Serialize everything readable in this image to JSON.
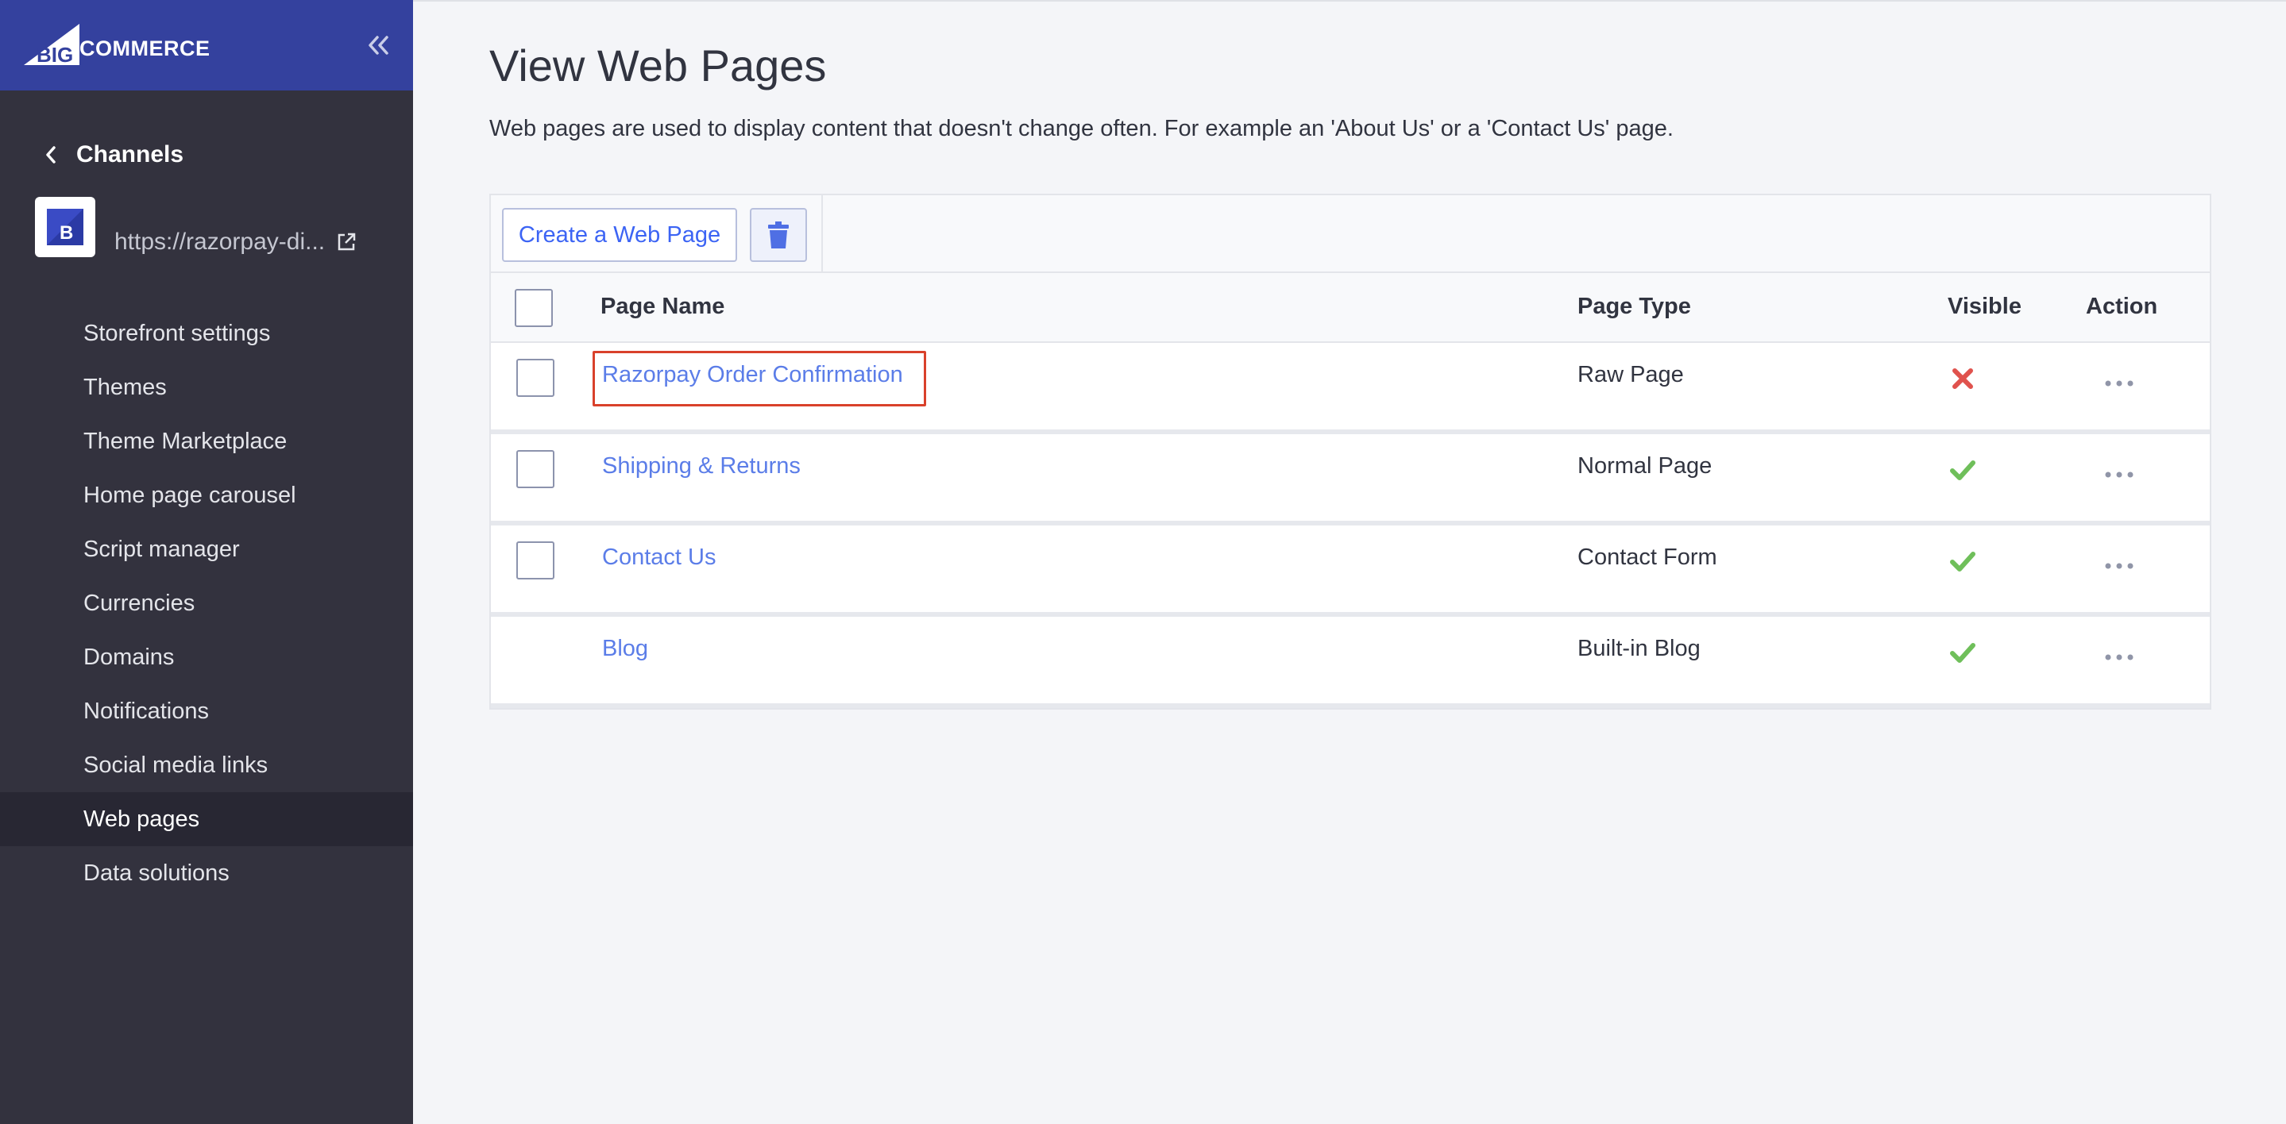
{
  "brand": {
    "logo_text": "COMMERCE",
    "logo_prefix": "BIG",
    "accent": "#34419e"
  },
  "sidebar": {
    "back_label": "Channels",
    "store_url": "https://razorpay-di...",
    "items": [
      {
        "label": "Storefront settings",
        "active": false
      },
      {
        "label": "Themes",
        "active": false
      },
      {
        "label": "Theme Marketplace",
        "active": false
      },
      {
        "label": "Home page carousel",
        "active": false
      },
      {
        "label": "Script manager",
        "active": false
      },
      {
        "label": "Currencies",
        "active": false
      },
      {
        "label": "Domains",
        "active": false
      },
      {
        "label": "Notifications",
        "active": false
      },
      {
        "label": "Social media links",
        "active": false
      },
      {
        "label": "Web pages",
        "active": true
      },
      {
        "label": "Data solutions",
        "active": false
      }
    ]
  },
  "main": {
    "title": "View Web Pages",
    "description": "Web pages are used to display content that doesn't change often. For example an 'About Us' or a 'Contact Us' page.",
    "toolbar": {
      "create_label": "Create a Web Page",
      "delete_icon": "trash-icon"
    },
    "table": {
      "columns": {
        "name": "Page Name",
        "type": "Page Type",
        "visible": "Visible",
        "action": "Action"
      },
      "rows": [
        {
          "name": "Razorpay Order Confirmation",
          "type": "Raw Page",
          "visible": false,
          "has_checkbox": true,
          "highlighted": true
        },
        {
          "name": "Shipping & Returns",
          "type": "Normal Page",
          "visible": true,
          "has_checkbox": true,
          "highlighted": false
        },
        {
          "name": "Contact Us",
          "type": "Contact Form",
          "visible": true,
          "has_checkbox": true,
          "highlighted": false
        },
        {
          "name": "Blog",
          "type": "Built-in Blog",
          "visible": true,
          "has_checkbox": false,
          "highlighted": false
        }
      ]
    }
  },
  "colors": {
    "link": "#5b7de8",
    "visible_yes": "#6fbf5a",
    "visible_no": "#e0524d",
    "highlight": "#d9412b"
  }
}
